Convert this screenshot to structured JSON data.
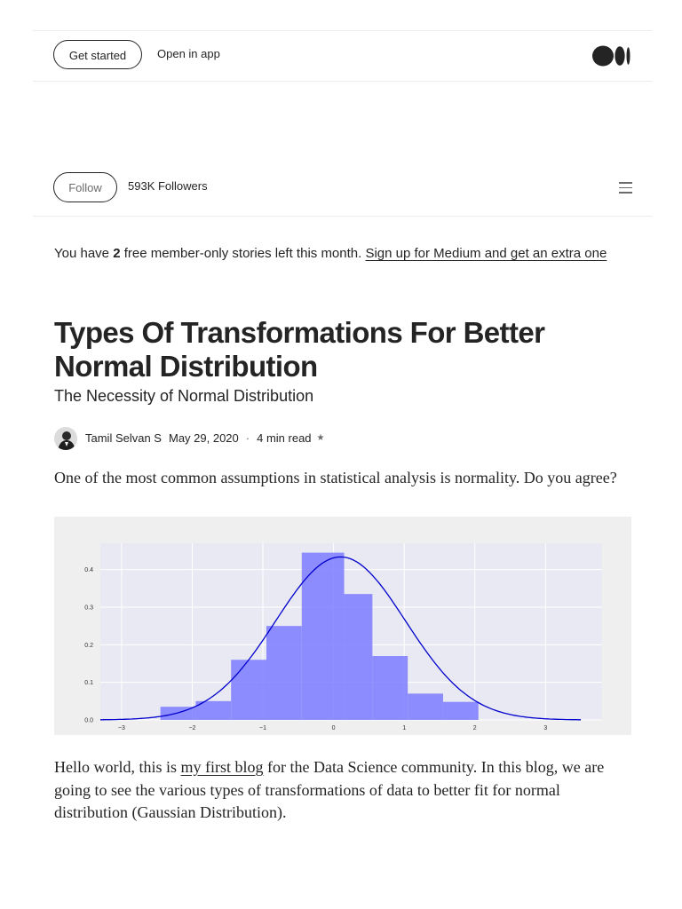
{
  "topbar": {
    "get_started": "Get started",
    "open_in_app": "Open in app"
  },
  "publication": {
    "follow": "Follow",
    "followers": "593K Followers"
  },
  "notice": {
    "prefix": "You have ",
    "count": "2",
    "middle": " free member-only stories left this month. ",
    "signup": "Sign up for Medium and get an extra one"
  },
  "article": {
    "title": "Types Of Transformations For Better Normal Distribution",
    "subtitle": "The Necessity of Normal Distribution",
    "author": "Tamil Selvan S",
    "date": "May 29, 2020",
    "separator": "·",
    "read_time": "4 min read",
    "member_star": "★",
    "intro": "One of the most common assumptions in statistical analysis is normality. Do you agree?",
    "body_before_link": "Hello world, this is ",
    "body_link": "my first blog",
    "body_after_link": " for the Data Science community. In this blog, we are going to see the various types of transformations of data to better fit for normal distribution (Gaussian Distribution)."
  },
  "colors": {
    "bar_fill": "#7b7bff",
    "curve": "#0000cc",
    "plot_bg": "#e9e9f3"
  },
  "chart_data": {
    "type": "bar",
    "title": "",
    "xlabel": "",
    "ylabel": "",
    "xlim": [
      -3.3,
      3.8
    ],
    "ylim": [
      0,
      0.47
    ],
    "grid": true,
    "xticks": [
      -3,
      -2,
      -1,
      0,
      1,
      2,
      3
    ],
    "xtick_labels": [
      "−3",
      "−2",
      "−1",
      "0",
      "1",
      "2",
      "3"
    ],
    "yticks": [
      0.0,
      0.1,
      0.2,
      0.3,
      0.4
    ],
    "ytick_labels": [
      "0.0",
      "0.1",
      "0.2",
      "0.3",
      "0.4"
    ],
    "bins": [
      {
        "x0": -2.45,
        "x1": -1.95,
        "value": 0.035
      },
      {
        "x0": -1.95,
        "x1": -1.45,
        "value": 0.05
      },
      {
        "x0": -1.45,
        "x1": -0.95,
        "value": 0.16
      },
      {
        "x0": -0.95,
        "x1": -0.45,
        "value": 0.25
      },
      {
        "x0": -0.45,
        "x1": 0.15,
        "value": 0.445
      },
      {
        "x0": 0.15,
        "x1": 0.55,
        "value": 0.335
      },
      {
        "x0": 0.55,
        "x1": 1.05,
        "value": 0.17
      },
      {
        "x0": 1.05,
        "x1": 1.55,
        "value": 0.07
      },
      {
        "x0": 1.55,
        "x1": 2.05,
        "value": 0.048
      }
    ],
    "curve": {
      "type": "normal-density",
      "mean": 0.1,
      "std": 0.92,
      "x_range": [
        -3.3,
        3.5
      ]
    }
  }
}
